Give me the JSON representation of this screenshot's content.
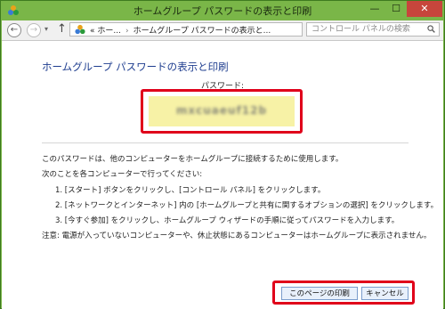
{
  "window": {
    "title": "ホームグループ パスワードの表示と印刷",
    "minimize_glyph": "—",
    "maximize_glyph": "☐",
    "close_glyph": "✕"
  },
  "navigation": {
    "back_glyph": "←",
    "forward_glyph": "→",
    "history_glyph": "▾",
    "up_glyph": "↑",
    "breadcrumb": [
      "« ホー...",
      "ホームグループ パスワードの表示と..."
    ],
    "separator": "›",
    "dropdown_glyph": "▾",
    "refresh_glyph": "↻",
    "search_placeholder": "コントロール パネルの検索"
  },
  "main": {
    "heading": "ホームグループ パスワードの表示と印刷",
    "password_label": "パスワード:",
    "password_value": "mxcuaeuf12b",
    "paragraphs": [
      "このパスワードは、他のコンピューターをホームグループに接続するために使用します。",
      "次のことを各コンピューターで行ってください:",
      "1. [スタート] ボタンをクリックし、[コントロール パネル] をクリックします。",
      "2. [ネットワークとインターネット] 内の [ホームグループと共有に関するオプションの選択] をクリックします。",
      "3. [今すぐ参加] をクリックし、ホームグループ ウィザードの手順に従ってパスワードを入力します。",
      "注意: 電源が入っていないコンピューターや、休止状態にあるコンピューターはホームグループに表示されません。"
    ]
  },
  "buttons": {
    "print_label": "このページの印刷",
    "cancel_label": "キャンセル"
  },
  "colors": {
    "titlebar": "#7ab648",
    "close_button": "#c7463c",
    "heading": "#1e3d8f",
    "highlight": "#e0001a",
    "password_background": "#f7f2a6"
  },
  "icons": {
    "app": "homegroup-icon",
    "address": "homegroup-icon",
    "search": "search-icon"
  }
}
